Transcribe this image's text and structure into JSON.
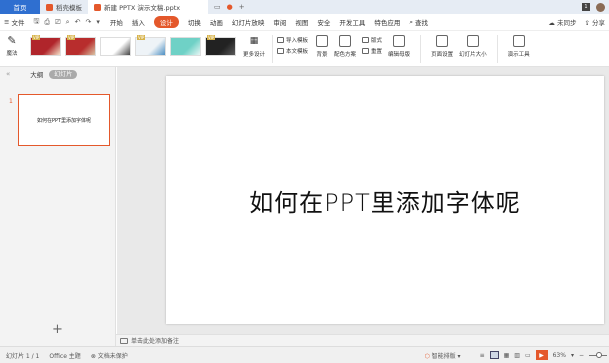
{
  "tabs": {
    "home": "首页",
    "wps": "稻壳模板",
    "document": "新建 PPTX 演示文稿.pptx",
    "add": "+",
    "right_box": "1"
  },
  "menu": {
    "file": "文件",
    "items": [
      "开始",
      "插入",
      "设计",
      "切换",
      "动画",
      "幻灯片放映",
      "审阅",
      "视图",
      "安全",
      "开发工具",
      "特色应用"
    ],
    "search": "查找",
    "sync": "未同步",
    "share": "分享"
  },
  "ribbon": {
    "magic": "魔法",
    "more_design": "更多设计",
    "import_template": "导入模板",
    "this_template": "本文模板",
    "background": "背景",
    "color_scheme": "配色方案",
    "format": "版式",
    "replace": "重置",
    "edit_master": "编辑母版",
    "page_setup": "页面设置",
    "slide_size": "幻灯片大小",
    "presenter": "演示工具",
    "thumbnails": [
      {
        "colors": [
          "#b0252b",
          "#f4e1c8"
        ],
        "vip": "VIP"
      },
      {
        "colors": [
          "#b82d2d",
          "#d9c3a3"
        ],
        "vip": "VIP"
      },
      {
        "colors": [
          "#ffffff",
          "#444444"
        ],
        "vip": ""
      },
      {
        "colors": [
          "#eef3f7",
          "#4c8ec2"
        ],
        "vip": "VIP"
      },
      {
        "colors": [
          "#6fd1c6",
          "#e7f6f4"
        ],
        "vip": ""
      },
      {
        "colors": [
          "#222222",
          "#5a5a5a"
        ],
        "vip": "VIP"
      }
    ]
  },
  "leftpanel": {
    "outline": "大纲",
    "slides_tab": "幻灯片",
    "slide_number": "1",
    "thumb_text": "如何在PPT里添加字体呢",
    "add": "+"
  },
  "slide": {
    "title": "如何在PPT里添加字体呢"
  },
  "notes": {
    "placeholder": "单击此处添加备注"
  },
  "status": {
    "slide_count": "幻灯片 1 / 1",
    "theme": "Office 主题",
    "protect": "文档未保护",
    "smart_format": "智能排版",
    "zoom": "63%"
  }
}
